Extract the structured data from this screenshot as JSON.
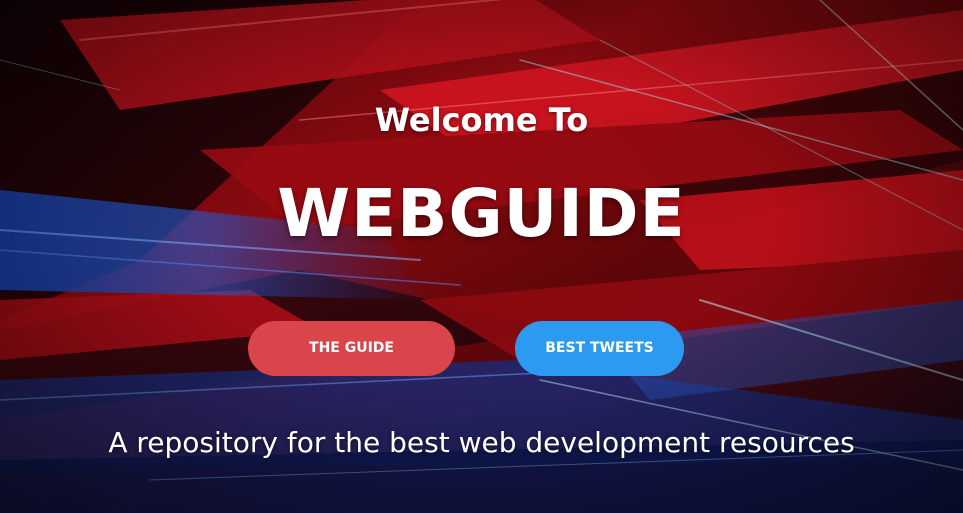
{
  "hero": {
    "welcome": "Welcome To",
    "title": "WEBGUIDE",
    "tagline": "A repository for the best web development resources",
    "background": "abstract-red-blue-light-streaks"
  },
  "buttons": {
    "guide_label": "THE GUIDE",
    "tweets_label": "BEST TWEETS"
  },
  "colors": {
    "guide_button": "#d9454b",
    "tweets_button": "#2b9af0",
    "text": "#ffffff"
  }
}
